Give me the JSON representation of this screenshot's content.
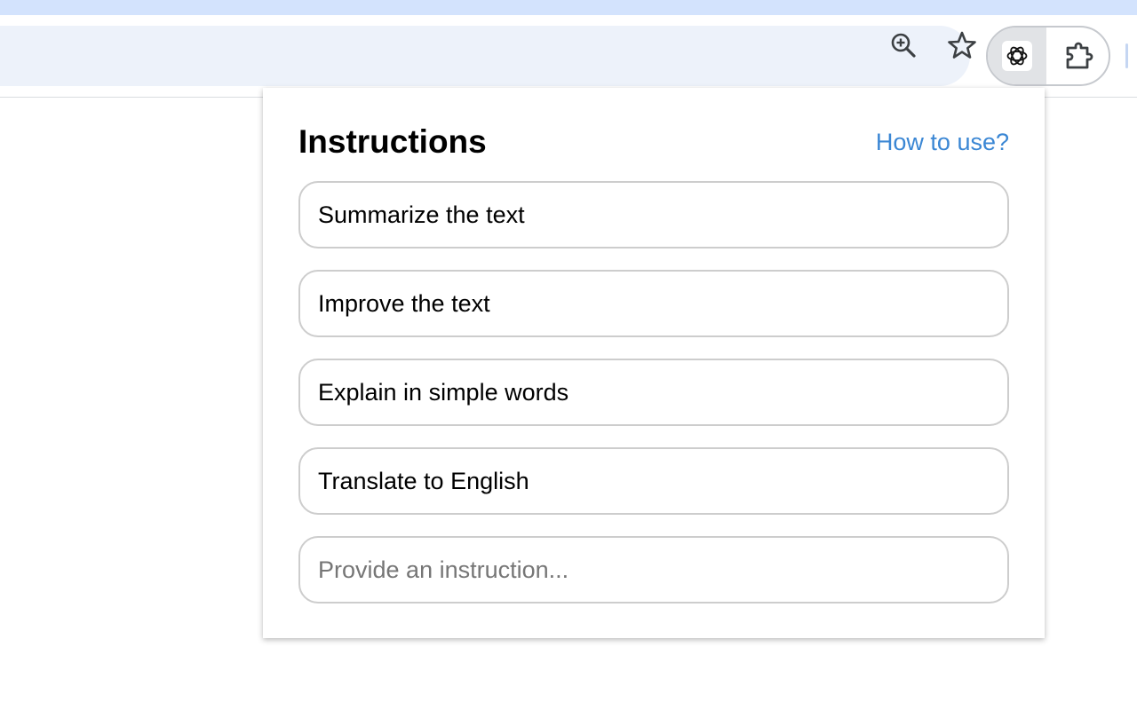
{
  "browser": {
    "toolbar_icons": [
      "zoom-in-icon",
      "bookmark-star-icon"
    ],
    "extensions": [
      "chatgpt-extension-icon",
      "extensions-puzzle-icon"
    ]
  },
  "popup": {
    "title": "Instructions",
    "help_link": "How to use?",
    "instructions": [
      {
        "label": "Summarize the text"
      },
      {
        "label": "Improve the text"
      },
      {
        "label": "Explain in simple words"
      },
      {
        "label": "Translate to English"
      }
    ],
    "custom_input": {
      "value": "",
      "placeholder": "Provide an instruction..."
    }
  },
  "colors": {
    "link": "#3b87d4",
    "omnibox_bg": "#edf2fa",
    "top_strip": "#d3e3fd",
    "button_border": "#cdcdcd"
  }
}
